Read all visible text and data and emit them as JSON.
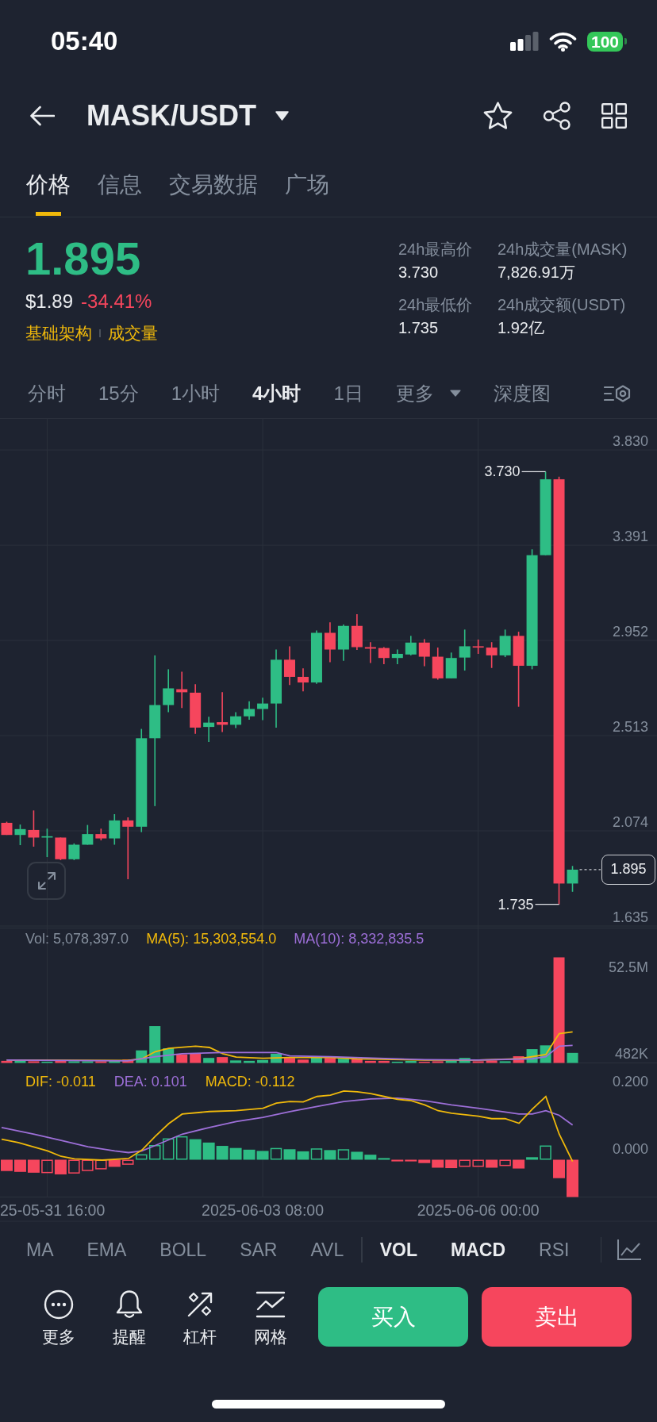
{
  "status_bar": {
    "time": "05:40",
    "battery": "100"
  },
  "header": {
    "title": "MASK/USDT"
  },
  "tabs": [
    {
      "label": "价格",
      "selected": true
    },
    {
      "label": "信息",
      "selected": false
    },
    {
      "label": "交易数据",
      "selected": false
    },
    {
      "label": "广场",
      "selected": false
    }
  ],
  "ticker": {
    "price": "1.895",
    "usd_price": "$1.89",
    "change": "-34.41%",
    "tags": [
      "基础架构",
      "成交量"
    ],
    "stats": [
      {
        "label": "24h最高价",
        "value": "3.730"
      },
      {
        "label": "24h成交量(MASK)",
        "value": "7,826.91万"
      },
      {
        "label": "24h最低价",
        "value": "1.735"
      },
      {
        "label": "24h成交额(USDT)",
        "value": "1.92亿"
      }
    ]
  },
  "intervals": [
    {
      "label": "分时",
      "kind": "tab",
      "selected": false
    },
    {
      "label": "15分",
      "kind": "tab",
      "selected": false
    },
    {
      "label": "1小时",
      "kind": "tab",
      "selected": false
    },
    {
      "label": "4小时",
      "kind": "tab",
      "selected": true
    },
    {
      "label": "1日",
      "kind": "tab",
      "selected": false
    },
    {
      "label": "更多",
      "kind": "dropdown",
      "selected": false
    },
    {
      "label": "深度图",
      "kind": "tab",
      "selected": false
    }
  ],
  "chart": {
    "chart_data": {
      "type": "candlestick",
      "ohlc": [
        [
          2.111,
          2.116,
          2.055,
          2.055
        ],
        [
          2.055,
          2.103,
          2.008,
          2.082
        ],
        [
          2.078,
          2.168,
          2.001,
          2.043
        ],
        [
          2.043,
          2.084,
          1.953,
          2.049
        ],
        [
          2.043,
          2.043,
          1.939,
          1.943
        ],
        [
          1.943,
          2.016,
          1.939,
          2.01
        ],
        [
          2.01,
          2.101,
          2.01,
          2.059
        ],
        [
          2.059,
          2.084,
          2.03,
          2.039
        ],
        [
          2.039,
          2.151,
          2.01,
          2.122
        ],
        [
          2.122,
          2.136,
          1.851,
          2.093
        ],
        [
          2.093,
          2.544,
          2.068,
          2.501
        ],
        [
          2.501,
          2.883,
          2.188,
          2.654
        ],
        [
          2.654,
          2.819,
          2.621,
          2.731
        ],
        [
          2.727,
          2.808,
          2.64,
          2.713
        ],
        [
          2.711,
          2.75,
          2.521,
          2.55
        ],
        [
          2.553,
          2.6,
          2.484,
          2.573
        ],
        [
          2.575,
          2.713,
          2.53,
          2.563
        ],
        [
          2.563,
          2.621,
          2.548,
          2.602
        ],
        [
          2.602,
          2.671,
          2.586,
          2.636
        ],
        [
          2.636,
          2.688,
          2.584,
          2.661
        ],
        [
          2.661,
          2.91,
          2.55,
          2.863
        ],
        [
          2.863,
          2.925,
          2.746,
          2.784
        ],
        [
          2.784,
          2.823,
          2.717,
          2.758
        ],
        [
          2.758,
          2.998,
          2.752,
          2.987
        ],
        [
          2.987,
          3.035,
          2.852,
          2.91
        ],
        [
          2.91,
          3.025,
          2.858,
          3.019
        ],
        [
          3.019,
          3.073,
          2.908,
          2.921
        ],
        [
          2.921,
          2.944,
          2.848,
          2.914
        ],
        [
          2.917,
          2.921,
          2.842,
          2.871
        ],
        [
          2.871,
          2.91,
          2.842,
          2.89
        ],
        [
          2.887,
          2.973,
          2.883,
          2.942
        ],
        [
          2.942,
          2.958,
          2.833,
          2.877
        ],
        [
          2.877,
          2.919,
          2.771,
          2.777
        ],
        [
          2.777,
          2.896,
          2.777,
          2.871
        ],
        [
          2.873,
          3.002,
          2.813,
          2.925
        ],
        [
          2.925,
          2.956,
          2.89,
          2.919
        ],
        [
          2.919,
          2.944,
          2.825,
          2.883
        ],
        [
          2.883,
          3.002,
          2.875,
          2.973
        ],
        [
          2.973,
          2.992,
          2.646,
          2.835
        ],
        [
          2.835,
          3.372,
          2.819,
          3.345
        ],
        [
          3.345,
          3.73,
          3.345,
          3.695
        ],
        [
          3.695,
          3.707,
          1.735,
          1.831
        ],
        [
          1.831,
          1.912,
          1.793,
          1.895
        ]
      ],
      "ylim": [
        1.624,
        3.973
      ],
      "yticks": [
        {
          "value": 3.83,
          "label": "3.830"
        },
        {
          "value": 3.391,
          "label": "3.391"
        },
        {
          "value": 2.952,
          "label": "2.952"
        },
        {
          "value": 2.513,
          "label": "2.513"
        },
        {
          "value": 2.074,
          "label": "2.074"
        },
        {
          "value": 1.635,
          "label": "1.635"
        }
      ],
      "grid": true,
      "annotations": [
        "3.730",
        "1.735"
      ]
    },
    "last_price": "1.895",
    "volume_legend": [
      {
        "text": "Vol: 5,078,397.0",
        "color": "#848e9c"
      },
      {
        "text": "MA(5): 15,303,554.0",
        "color": "#f0b90b"
      },
      {
        "text": "MA(10): 8,332,835.5",
        "color": "#9d6fd8"
      }
    ],
    "volume_axis": [
      "52.5M",
      "482K"
    ],
    "macd_legend": [
      {
        "text": "DIF: -0.011",
        "color": "#f0b90b"
      },
      {
        "text": "DEA: 0.101",
        "color": "#9d6fd8"
      },
      {
        "text": "MACD: -0.112",
        "color": "#f0b90b"
      }
    ],
    "macd_axis": [
      "0.200",
      "0.000"
    ],
    "time_axis": [
      "25-05-31 16:00",
      "2025-06-03 08:00",
      "2025-06-06 00:00"
    ]
  },
  "main_indicators": [
    {
      "label": "MA",
      "selected": false
    },
    {
      "label": "EMA",
      "selected": false
    },
    {
      "label": "BOLL",
      "selected": false
    },
    {
      "label": "SAR",
      "selected": false
    },
    {
      "label": "AVL",
      "selected": false
    }
  ],
  "sub_indicators": [
    {
      "label": "VOL",
      "selected": true
    },
    {
      "label": "MACD",
      "selected": true
    },
    {
      "label": "RSI",
      "selected": false
    }
  ],
  "actions": [
    {
      "label": "更多",
      "kind": "more"
    },
    {
      "label": "提醒",
      "kind": "alert"
    },
    {
      "label": "杠杆",
      "kind": "leverage"
    },
    {
      "label": "网格",
      "kind": "grid"
    }
  ],
  "trade": [
    {
      "label": "买入",
      "kind": "buy"
    },
    {
      "label": "卖出",
      "kind": "sell"
    }
  ]
}
